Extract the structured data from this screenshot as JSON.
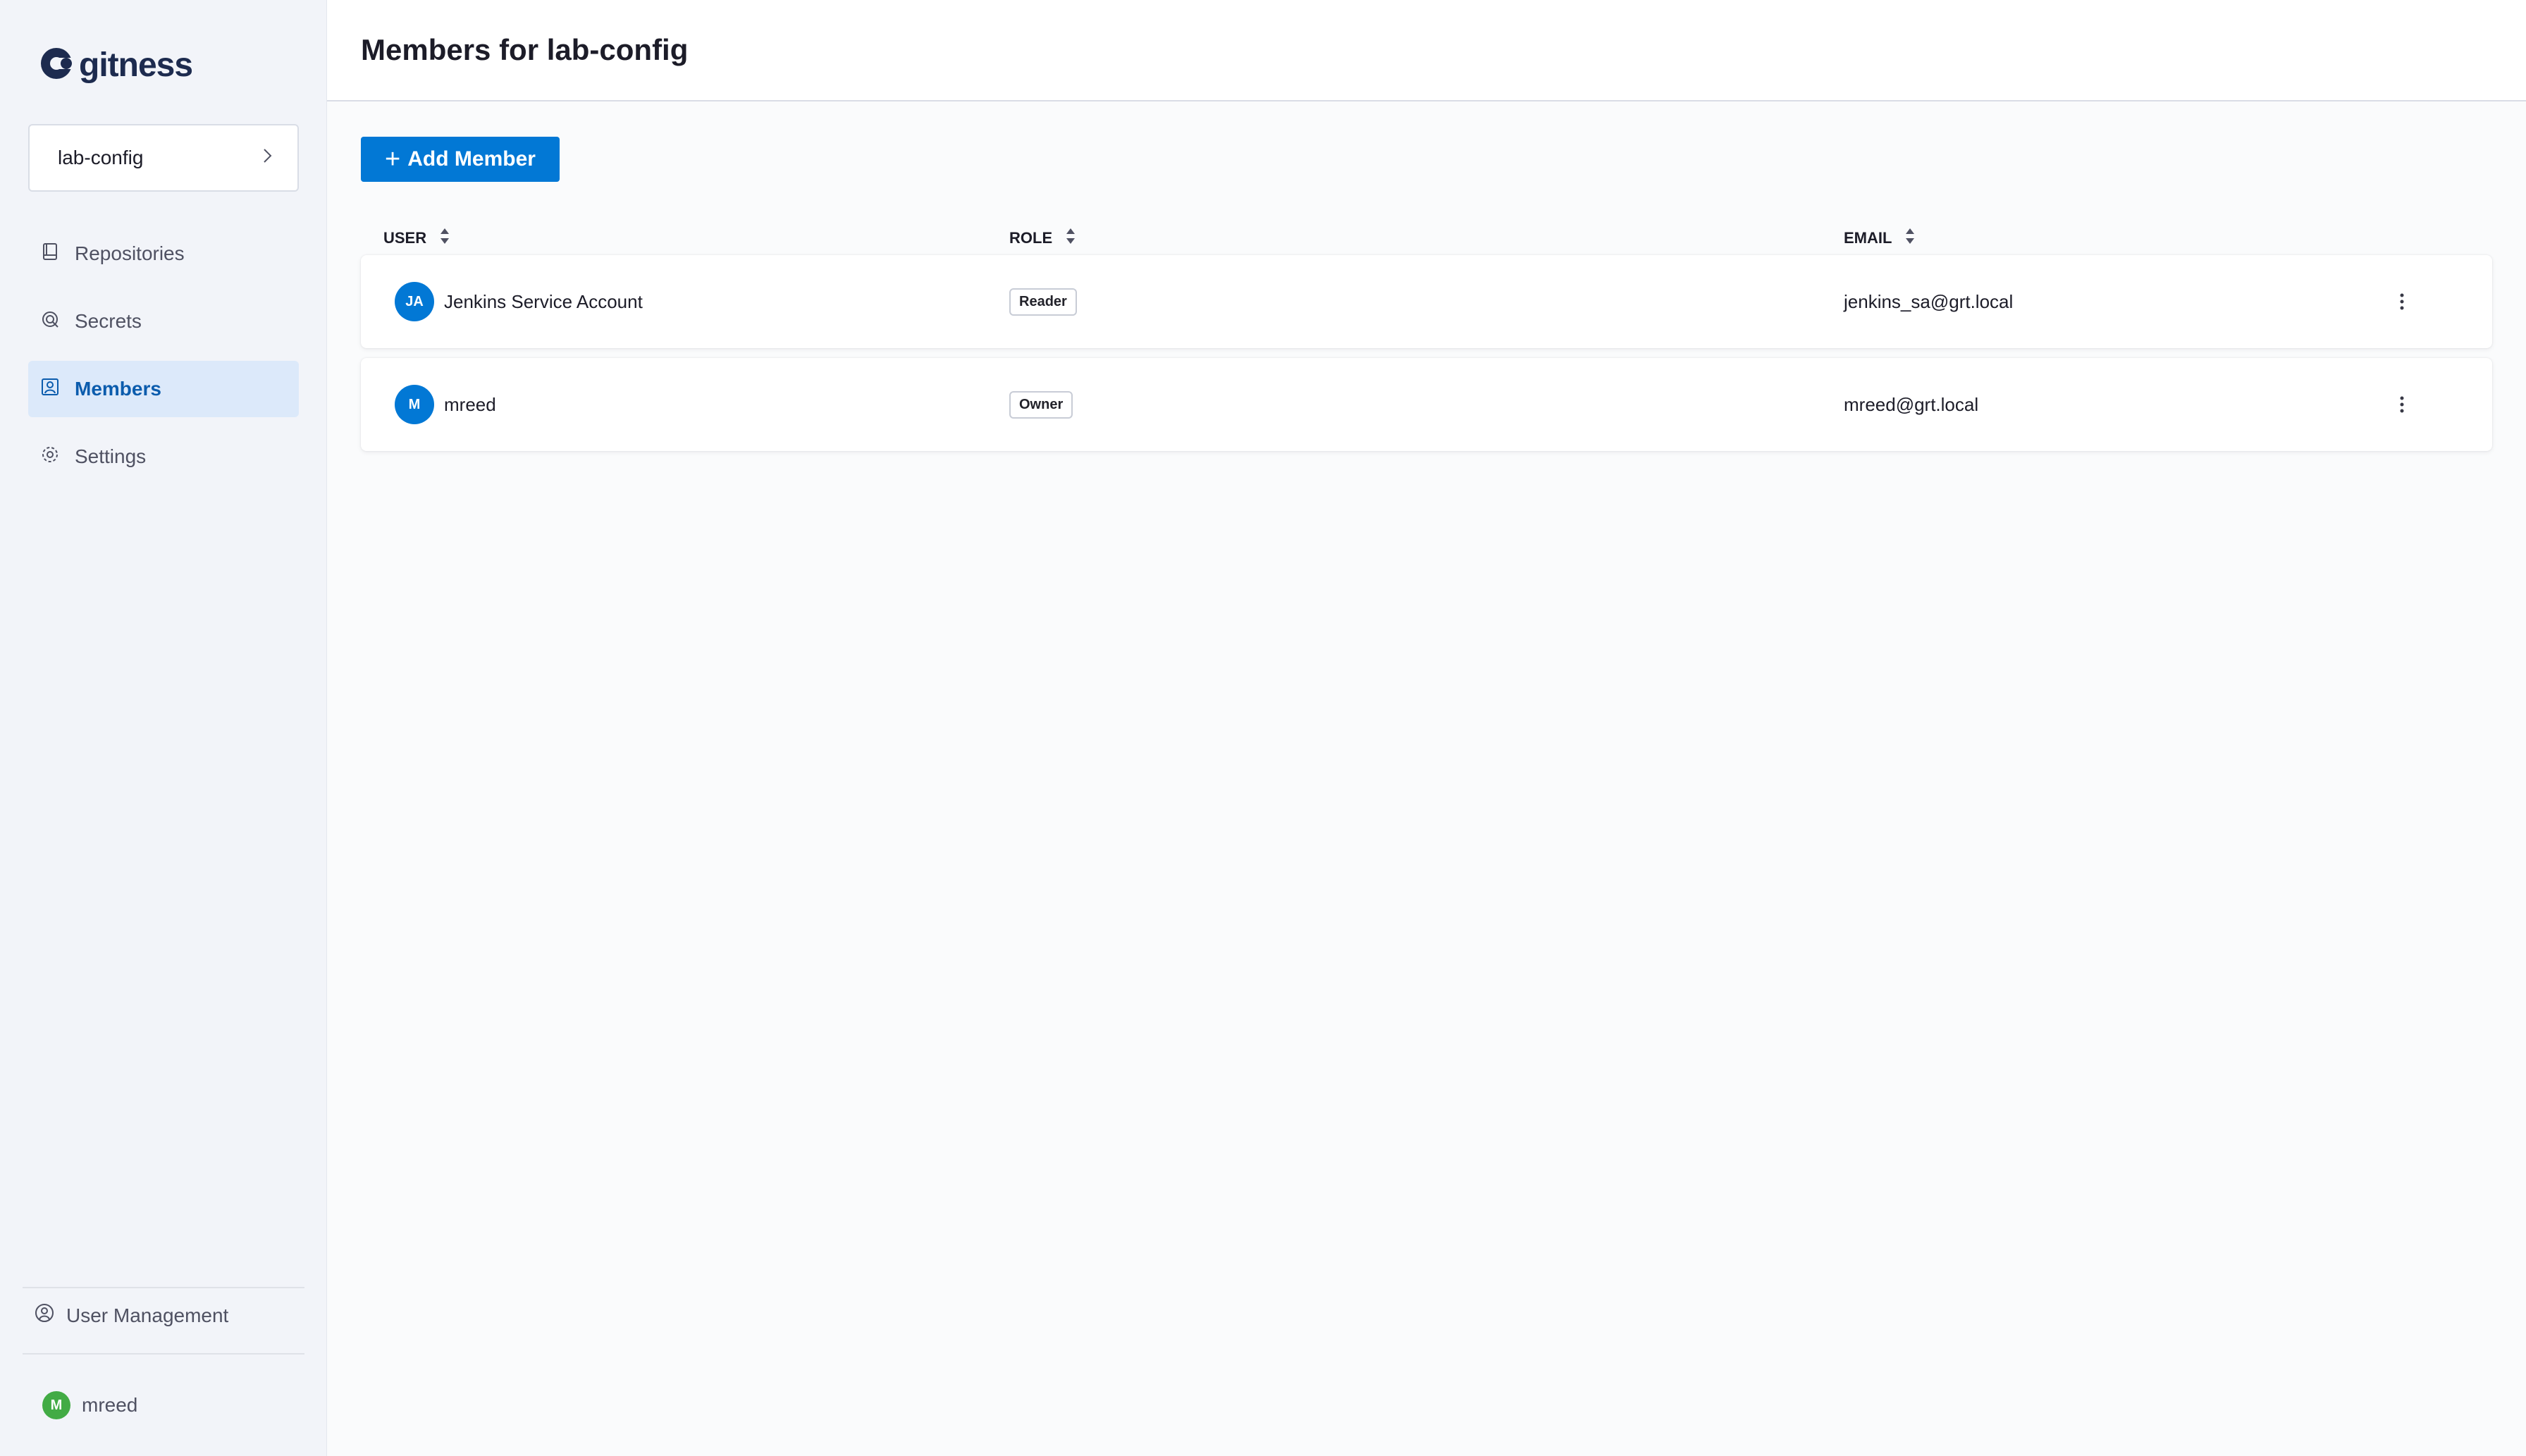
{
  "brand": {
    "name": "gitness",
    "logo_icon": "gitness-logo-icon"
  },
  "space": {
    "name": "lab-config",
    "icon": "chevron-right-icon"
  },
  "nav": [
    {
      "label": "Repositories",
      "icon": "repository-icon",
      "active": false
    },
    {
      "label": "Secrets",
      "icon": "secrets-icon",
      "active": false
    },
    {
      "label": "Members",
      "icon": "members-icon",
      "active": true
    },
    {
      "label": "Settings",
      "icon": "gear-icon",
      "active": false
    }
  ],
  "footer": {
    "user_management": "User Management",
    "current_user": {
      "initial": "M",
      "name": "mreed"
    }
  },
  "page": {
    "title": "Members for lab-config",
    "add_button": "Add Member"
  },
  "table": {
    "columns": {
      "user": "USER",
      "role": "ROLE",
      "email": "EMAIL"
    },
    "rows": [
      {
        "initials": "JA",
        "name": "Jenkins Service Account",
        "role": "Reader",
        "email": "jenkins_sa@grt.local"
      },
      {
        "initials": "M",
        "name": "mreed",
        "role": "Owner",
        "email": "mreed@grt.local"
      }
    ]
  },
  "colors": {
    "primary": "#0278d5",
    "sidebar_bg": "#f2f4f9",
    "active_nav_bg": "#dce9fa",
    "active_nav_text": "#0b5cad",
    "user_avatar": "#42ab45"
  }
}
